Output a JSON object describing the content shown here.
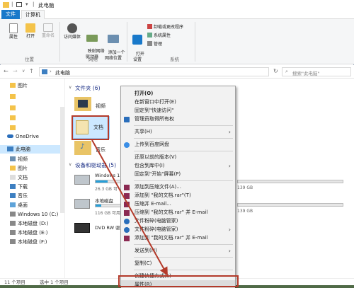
{
  "window": {
    "title": "此电脑"
  },
  "tabs": {
    "file": "文件",
    "computer": "计算机"
  },
  "ribbon": {
    "location": {
      "properties": "属性",
      "open": "打开",
      "rename": "重命名",
      "group": "位置"
    },
    "network": {
      "access_media": "访问媒体",
      "map_drive": "映射网络\n驱动器",
      "add_location": "添加一个\n网络位置",
      "group": "网络"
    },
    "system": {
      "open_settings": "打开\n设置",
      "uninstall": "卸载或更改程序",
      "system_props": "系统属性",
      "manage": "管理",
      "group": "系统"
    }
  },
  "address": {
    "path": "此电脑",
    "search_placeholder": "搜索\"此电脑\""
  },
  "nav": {
    "items": [
      {
        "label": "图片"
      },
      {
        "label": ""
      },
      {
        "label": ""
      },
      {
        "label": ""
      },
      {
        "label": ""
      },
      {
        "label": "OneDrive"
      },
      {
        "label": "此电脑"
      },
      {
        "label": "视频"
      },
      {
        "label": "图片"
      },
      {
        "label": "文档"
      },
      {
        "label": "下载"
      },
      {
        "label": "音乐"
      },
      {
        "label": "桌面"
      },
      {
        "label": "Windows 10 (C:)"
      },
      {
        "label": "本地磁盘 (D:)"
      },
      {
        "label": "本地磁盘 (E:)"
      },
      {
        "label": "本地磁盘 (F:)"
      }
    ]
  },
  "content": {
    "folders_header": "文件夹 (6)",
    "folders": [
      {
        "label": "视频"
      },
      {
        "label": "文档"
      },
      {
        "label": "音乐"
      }
    ],
    "drives_header": "设备和驱动器 (5)",
    "drives": [
      {
        "name": "Windows 1",
        "info": "26.3 GB 可",
        "used_fraction": 0.45
      },
      {
        "name": "本地磁盘",
        "info": "116 GB 可用",
        "used_fraction": 0.2
      },
      {
        "name": "DVD RW 驱",
        "info": ""
      }
    ],
    "right_sizes": [
      "139 GB",
      "139 GB"
    ]
  },
  "status": {
    "items": "11 个项目",
    "selected": "选中 1 个项目"
  },
  "context_menu": {
    "items": [
      {
        "label": "打开(O)",
        "bold": true
      },
      {
        "label": "在新窗口中打开(E)"
      },
      {
        "label": "固定到\"快速访问\""
      },
      {
        "label": "管理员取得所有权"
      },
      {
        "label": "共享(H)",
        "submenu": true
      },
      {
        "label": "上传到百度网盘"
      },
      {
        "label": "还原以前的版本(V)"
      },
      {
        "label": "包含到库中(I)",
        "submenu": true
      },
      {
        "label": "固定到\"开始\"屏幕(P)"
      },
      {
        "label": "添加到压缩文件(A)..."
      },
      {
        "label": "添加到 \"我的文档.rar\"(T)"
      },
      {
        "label": "压缩并 E-mail..."
      },
      {
        "label": "压缩到 \"我的文档.rar\" 并 E-mail"
      },
      {
        "label": "文件粉碎(电脑管家)"
      },
      {
        "label": "文件粉碎(电脑管家)",
        "submenu": true
      },
      {
        "label": "添加到 \"我的文档.rar\" 并 E-mail"
      },
      {
        "label": "发送到(N)",
        "submenu": true
      },
      {
        "label": "复制(C)"
      },
      {
        "label": "创建快捷方式(S)"
      },
      {
        "label": "属性(R)"
      }
    ]
  },
  "colors": {
    "accent": "#1979ca",
    "annotation": "#b33a2a",
    "folder": "#f4c34a"
  }
}
